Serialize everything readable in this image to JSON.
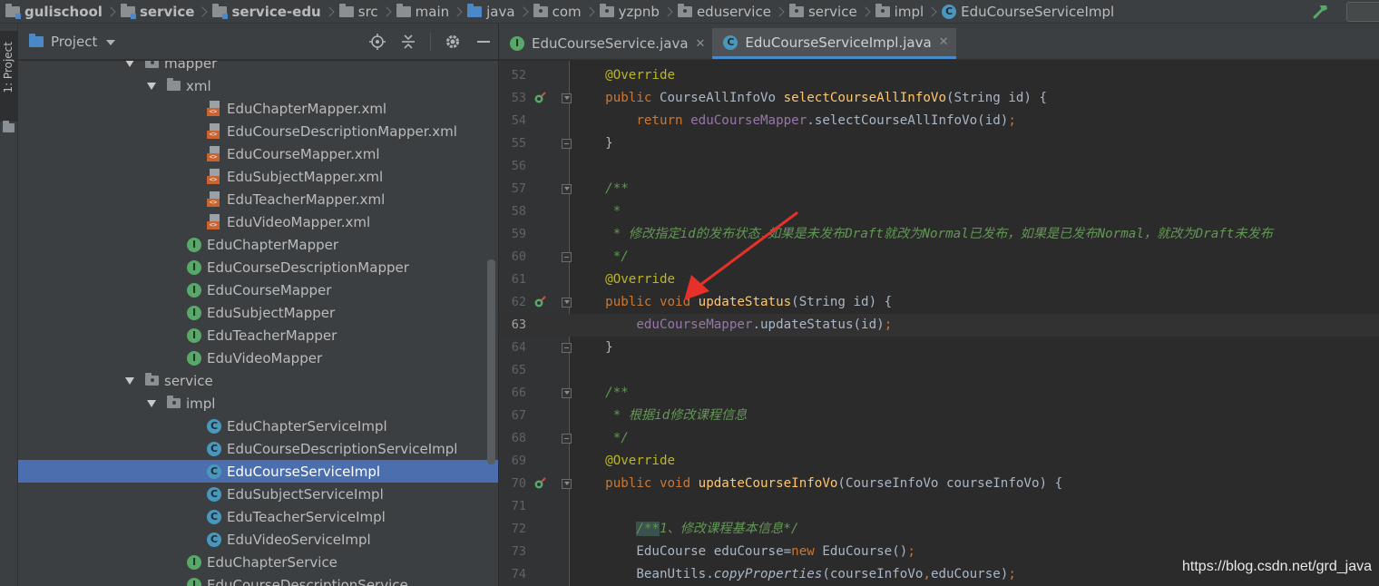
{
  "breadcrumb": [
    {
      "label": "gulischool",
      "icon": "module-folder-icon",
      "bold": true
    },
    {
      "label": "service",
      "icon": "module-folder-icon",
      "bold": true
    },
    {
      "label": "service-edu",
      "icon": "module-folder-icon",
      "bold": true
    },
    {
      "label": "src",
      "icon": "folder-icon",
      "bold": false
    },
    {
      "label": "main",
      "icon": "folder-icon",
      "bold": false
    },
    {
      "label": "java",
      "icon": "source-folder-icon",
      "bold": false
    },
    {
      "label": "com",
      "icon": "package-icon",
      "bold": false
    },
    {
      "label": "yzpnb",
      "icon": "package-icon",
      "bold": false
    },
    {
      "label": "eduservice",
      "icon": "package-icon",
      "bold": false
    },
    {
      "label": "service",
      "icon": "package-icon",
      "bold": false
    },
    {
      "label": "impl",
      "icon": "package-icon",
      "bold": false
    },
    {
      "label": "EduCourseServiceImpl",
      "icon": "class-icon",
      "bold": false
    }
  ],
  "toolstrip": {
    "project_tab": "1: Project"
  },
  "project_panel": {
    "title": "Project"
  },
  "tree": [
    {
      "label": "mapper",
      "type": "package",
      "indent": 160,
      "expanded": true
    },
    {
      "label": "xml",
      "type": "folder",
      "indent": 184,
      "expanded": true
    },
    {
      "label": "EduChapterMapper.xml",
      "type": "xml",
      "indent": 228
    },
    {
      "label": "EduCourseDescriptionMapper.xml",
      "type": "xml",
      "indent": 228
    },
    {
      "label": "EduCourseMapper.xml",
      "type": "xml",
      "indent": 228
    },
    {
      "label": "EduSubjectMapper.xml",
      "type": "xml",
      "indent": 228
    },
    {
      "label": "EduTeacherMapper.xml",
      "type": "xml",
      "indent": 228
    },
    {
      "label": "EduVideoMapper.xml",
      "type": "xml",
      "indent": 228
    },
    {
      "label": "EduChapterMapper",
      "type": "interface",
      "indent": 206
    },
    {
      "label": "EduCourseDescriptionMapper",
      "type": "interface",
      "indent": 206
    },
    {
      "label": "EduCourseMapper",
      "type": "interface",
      "indent": 206
    },
    {
      "label": "EduSubjectMapper",
      "type": "interface",
      "indent": 206
    },
    {
      "label": "EduTeacherMapper",
      "type": "interface",
      "indent": 206
    },
    {
      "label": "EduVideoMapper",
      "type": "interface",
      "indent": 206
    },
    {
      "label": "service",
      "type": "package",
      "indent": 160,
      "expanded": true
    },
    {
      "label": "impl",
      "type": "package",
      "indent": 184,
      "expanded": true
    },
    {
      "label": "EduChapterServiceImpl",
      "type": "class",
      "indent": 228
    },
    {
      "label": "EduCourseDescriptionServiceImpl",
      "type": "class",
      "indent": 228
    },
    {
      "label": "EduCourseServiceImpl",
      "type": "class",
      "indent": 228,
      "selected": true
    },
    {
      "label": "EduSubjectServiceImpl",
      "type": "class",
      "indent": 228
    },
    {
      "label": "EduTeacherServiceImpl",
      "type": "class",
      "indent": 228
    },
    {
      "label": "EduVideoServiceImpl",
      "type": "class",
      "indent": 228
    },
    {
      "label": "EduChapterService",
      "type": "interface",
      "indent": 206
    },
    {
      "label": "EduCourseDescriptionService",
      "type": "interface",
      "indent": 206
    }
  ],
  "tabs": [
    {
      "label": "EduCourseService.java",
      "icon": "interface-icon",
      "active": false
    },
    {
      "label": "EduCourseServiceImpl.java",
      "icon": "class-icon",
      "active": true
    }
  ],
  "editor": {
    "current_line": 63,
    "lines": [
      {
        "n": "52",
        "tokens": [
          [
            "a",
            "    @Override"
          ]
        ]
      },
      {
        "n": "53",
        "impl": true,
        "tokens": [
          [
            "k",
            "    public "
          ],
          [
            "t",
            "CourseAllInfoVo "
          ],
          [
            "m",
            "selectCourseAllInfoVo"
          ],
          [
            "t",
            "(String id) {"
          ]
        ]
      },
      {
        "n": "54",
        "tokens": [
          [
            "k",
            "        return "
          ],
          [
            "f",
            "eduCourseMapper"
          ],
          [
            "t",
            ".selectCourseAllInfoVo(id)"
          ],
          [
            "k",
            ";"
          ]
        ]
      },
      {
        "n": "55",
        "tokens": [
          [
            "t",
            "    }"
          ]
        ]
      },
      {
        "n": "56",
        "tokens": []
      },
      {
        "n": "57",
        "tokens": [
          [
            "d",
            "    /**"
          ]
        ]
      },
      {
        "n": "58",
        "tokens": [
          [
            "d",
            "     *"
          ]
        ]
      },
      {
        "n": "59",
        "tokens": [
          [
            "d",
            "     * 修改指定id的发布状态,如果是未发布Draft就改为Normal已发布，如果是已发布Normal，就改为Draft未发布"
          ]
        ]
      },
      {
        "n": "60",
        "tokens": [
          [
            "d",
            "     */"
          ]
        ]
      },
      {
        "n": "61",
        "tokens": [
          [
            "a",
            "    @Override"
          ]
        ]
      },
      {
        "n": "62",
        "impl": true,
        "tokens": [
          [
            "k",
            "    public void "
          ],
          [
            "m",
            "updateStatus"
          ],
          [
            "t",
            "(String id) {"
          ]
        ]
      },
      {
        "n": "63",
        "tokens": [
          [
            "f",
            "        eduCourseMapper"
          ],
          [
            "t",
            ".updateStatus(id)"
          ],
          [
            "k",
            ";"
          ]
        ]
      },
      {
        "n": "64",
        "tokens": [
          [
            "t",
            "    }"
          ]
        ]
      },
      {
        "n": "65",
        "tokens": []
      },
      {
        "n": "66",
        "tokens": [
          [
            "d",
            "    /**"
          ]
        ]
      },
      {
        "n": "67",
        "tokens": [
          [
            "d",
            "     * 根据id修改课程信息"
          ]
        ]
      },
      {
        "n": "68",
        "tokens": [
          [
            "d",
            "     */"
          ]
        ]
      },
      {
        "n": "69",
        "tokens": [
          [
            "a",
            "    @Override"
          ]
        ]
      },
      {
        "n": "70",
        "impl": true,
        "tokens": [
          [
            "k",
            "    public void "
          ],
          [
            "m",
            "updateCourseInfoVo"
          ],
          [
            "t",
            "(CourseInfoVo courseInfoVo) {"
          ]
        ]
      },
      {
        "n": "71",
        "tokens": []
      },
      {
        "n": "72",
        "tokens": [
          [
            "t",
            "        "
          ],
          [
            "hl",
            "/**"
          ],
          [
            "d",
            "1、修改课程基本信息*/"
          ]
        ]
      },
      {
        "n": "73",
        "tokens": [
          [
            "t",
            "        EduCourse eduCourse="
          ],
          [
            "k",
            "new "
          ],
          [
            "t",
            "EduCourse()"
          ],
          [
            "k",
            ";"
          ]
        ]
      },
      {
        "n": "74",
        "tokens": [
          [
            "t",
            "        BeanUtils."
          ],
          [
            "i",
            "copyProperties"
          ],
          [
            "t",
            "(courseInfoVo"
          ],
          [
            "k",
            ","
          ],
          [
            "t",
            "eduCourse)"
          ],
          [
            "k",
            ";"
          ]
        ]
      }
    ]
  },
  "watermark": "https://blog.csdn.net/grd_java",
  "colors": {
    "keyword": "#cc7832",
    "annotation": "#bbb529",
    "method": "#ffc66d",
    "field": "#9876aa",
    "doc_comment": "#629755",
    "selection": "#4b6eaf",
    "arrow": "#e8302b"
  }
}
